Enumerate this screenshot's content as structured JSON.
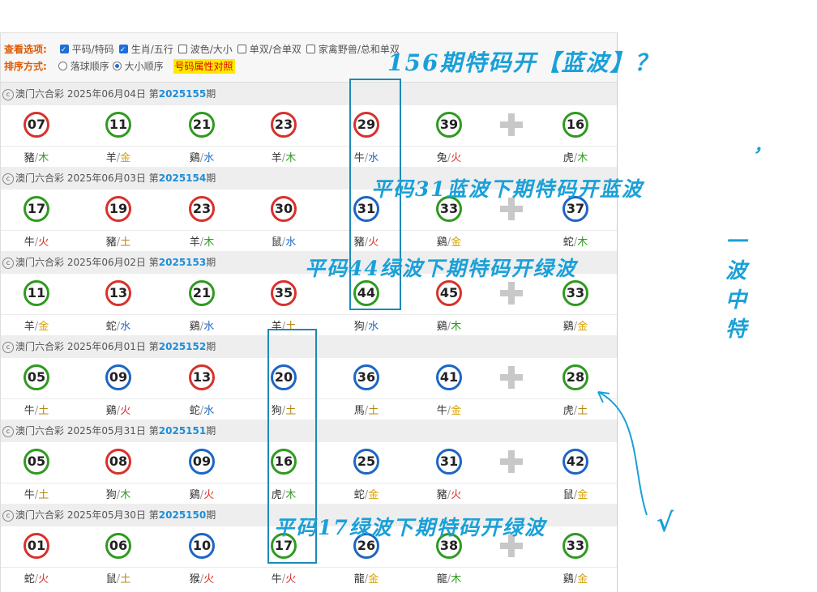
{
  "options": {
    "view_label": "查看选项:",
    "checks": [
      {
        "label": "平码/特码",
        "checked": true
      },
      {
        "label": "生肖/五行",
        "checked": true
      },
      {
        "label": "波色/大小",
        "checked": false
      },
      {
        "label": "单双/合单双",
        "checked": false
      },
      {
        "label": "家禽野兽/总和单双",
        "checked": false
      }
    ],
    "sort_label": "排序方式:",
    "sort_options": [
      {
        "label": "落球顺序",
        "selected": false
      },
      {
        "label": "大小顺序",
        "selected": true
      }
    ],
    "attr_button": "号码属性对照"
  },
  "colors": {
    "red": "#d8312c",
    "blue": "#1d66c4",
    "green": "#2f9a20",
    "wood": "#2f9a20",
    "gold": "#d4a000",
    "water": "#1d66c4",
    "fire": "#d8312c",
    "earth": "#b8860b"
  },
  "draws": [
    {
      "lottery": "澳门六合彩",
      "date": "2025年06月04日",
      "issue_prefix": "第",
      "issue": "2025155",
      "issue_suffix": "期",
      "balls": [
        {
          "n": "07",
          "c": "red",
          "z": "豬",
          "e": "木"
        },
        {
          "n": "11",
          "c": "green",
          "z": "羊",
          "e": "金"
        },
        {
          "n": "21",
          "c": "green",
          "z": "鷄",
          "e": "水"
        },
        {
          "n": "23",
          "c": "red",
          "z": "羊",
          "e": "木"
        },
        {
          "n": "29",
          "c": "red",
          "z": "牛",
          "e": "水"
        },
        {
          "n": "39",
          "c": "green",
          "z": "兔",
          "e": "火"
        },
        {
          "n": "16",
          "c": "green",
          "z": "虎",
          "e": "木"
        }
      ]
    },
    {
      "lottery": "澳门六合彩",
      "date": "2025年06月03日",
      "issue_prefix": "第",
      "issue": "2025154",
      "issue_suffix": "期",
      "balls": [
        {
          "n": "17",
          "c": "green",
          "z": "牛",
          "e": "火"
        },
        {
          "n": "19",
          "c": "red",
          "z": "豬",
          "e": "土"
        },
        {
          "n": "23",
          "c": "red",
          "z": "羊",
          "e": "木"
        },
        {
          "n": "30",
          "c": "red",
          "z": "鼠",
          "e": "水"
        },
        {
          "n": "31",
          "c": "blue",
          "z": "豬",
          "e": "火"
        },
        {
          "n": "33",
          "c": "green",
          "z": "鷄",
          "e": "金"
        },
        {
          "n": "37",
          "c": "blue",
          "z": "蛇",
          "e": "木"
        }
      ]
    },
    {
      "lottery": "澳门六合彩",
      "date": "2025年06月02日",
      "issue_prefix": "第",
      "issue": "2025153",
      "issue_suffix": "期",
      "balls": [
        {
          "n": "11",
          "c": "green",
          "z": "羊",
          "e": "金"
        },
        {
          "n": "13",
          "c": "red",
          "z": "蛇",
          "e": "水"
        },
        {
          "n": "21",
          "c": "green",
          "z": "鷄",
          "e": "水"
        },
        {
          "n": "35",
          "c": "red",
          "z": "羊",
          "e": "土"
        },
        {
          "n": "44",
          "c": "green",
          "z": "狗",
          "e": "水"
        },
        {
          "n": "45",
          "c": "red",
          "z": "鷄",
          "e": "木"
        },
        {
          "n": "33",
          "c": "green",
          "z": "鷄",
          "e": "金"
        }
      ]
    },
    {
      "lottery": "澳门六合彩",
      "date": "2025年06月01日",
      "issue_prefix": "第",
      "issue": "2025152",
      "issue_suffix": "期",
      "balls": [
        {
          "n": "05",
          "c": "green",
          "z": "牛",
          "e": "土"
        },
        {
          "n": "09",
          "c": "blue",
          "z": "鷄",
          "e": "火"
        },
        {
          "n": "13",
          "c": "red",
          "z": "蛇",
          "e": "水"
        },
        {
          "n": "20",
          "c": "blue",
          "z": "狗",
          "e": "土"
        },
        {
          "n": "36",
          "c": "blue",
          "z": "馬",
          "e": "土"
        },
        {
          "n": "41",
          "c": "blue",
          "z": "牛",
          "e": "金"
        },
        {
          "n": "28",
          "c": "green",
          "z": "虎",
          "e": "土"
        }
      ]
    },
    {
      "lottery": "澳门六合彩",
      "date": "2025年05月31日",
      "issue_prefix": "第",
      "issue": "2025151",
      "issue_suffix": "期",
      "balls": [
        {
          "n": "05",
          "c": "green",
          "z": "牛",
          "e": "土"
        },
        {
          "n": "08",
          "c": "red",
          "z": "狗",
          "e": "木"
        },
        {
          "n": "09",
          "c": "blue",
          "z": "鷄",
          "e": "火"
        },
        {
          "n": "16",
          "c": "green",
          "z": "虎",
          "e": "木"
        },
        {
          "n": "25",
          "c": "blue",
          "z": "蛇",
          "e": "金"
        },
        {
          "n": "31",
          "c": "blue",
          "z": "豬",
          "e": "火"
        },
        {
          "n": "42",
          "c": "blue",
          "z": "鼠",
          "e": "金"
        }
      ]
    },
    {
      "lottery": "澳门六合彩",
      "date": "2025年05月30日",
      "issue_prefix": "第",
      "issue": "2025150",
      "issue_suffix": "期",
      "balls": [
        {
          "n": "01",
          "c": "red",
          "z": "蛇",
          "e": "火"
        },
        {
          "n": "06",
          "c": "green",
          "z": "鼠",
          "e": "土"
        },
        {
          "n": "10",
          "c": "blue",
          "z": "猴",
          "e": "火"
        },
        {
          "n": "17",
          "c": "green",
          "z": "牛",
          "e": "火"
        },
        {
          "n": "26",
          "c": "blue",
          "z": "龍",
          "e": "金"
        },
        {
          "n": "38",
          "c": "green",
          "z": "龍",
          "e": "木"
        },
        {
          "n": "33",
          "c": "green",
          "z": "鷄",
          "e": "金"
        }
      ]
    }
  ],
  "annotations": {
    "top": "156期特码开【蓝波】？",
    "comma": "，",
    "note1": "平码31蓝波下期特码开蓝波",
    "note2": "平码44绿波下期特码开绿波",
    "note3": "平码17绿波下期特码开绿波",
    "check": "√",
    "side": [
      "一",
      "波",
      "中",
      "特"
    ]
  }
}
